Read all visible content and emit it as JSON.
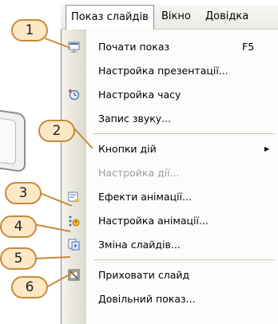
{
  "menubar": {
    "items": [
      {
        "label": "Показ слайдів",
        "active": true
      },
      {
        "label": "Вікно",
        "active": false
      },
      {
        "label": "Довідка",
        "active": false
      }
    ]
  },
  "menu": {
    "items": [
      {
        "label": "Почати показ",
        "shortcut": "F5",
        "icon": "slideshow-icon",
        "disabled": false
      },
      {
        "label": "Настройка презентації...",
        "icon": "",
        "disabled": false
      },
      {
        "label": "Настройка часу",
        "icon": "rehearse-timings-icon",
        "disabled": false
      },
      {
        "label": "Запис звуку...",
        "icon": "",
        "disabled": false
      },
      {
        "label": "Кнопки дій",
        "icon": "",
        "disabled": false,
        "submenu": true
      },
      {
        "label": "Настройка дії...",
        "icon": "",
        "disabled": true
      },
      {
        "label": "Ефекти анімації...",
        "icon": "animation-schemes-icon",
        "disabled": false
      },
      {
        "label": "Настройка анімації...",
        "icon": "custom-animation-icon",
        "disabled": false
      },
      {
        "label": "Зміна слайдів...",
        "icon": "slide-transition-icon",
        "disabled": false
      },
      {
        "label": "Приховати слайд",
        "icon": "hide-slide-icon",
        "disabled": false
      },
      {
        "label": "Довільний показ...",
        "icon": "",
        "disabled": false
      }
    ]
  },
  "callouts": [
    "1",
    "2",
    "3",
    "4",
    "5",
    "6"
  ],
  "colors": {
    "callout_fill": "#fde8c6",
    "callout_border": "#c88a3a",
    "disabled_text": "#9c9c9c"
  }
}
